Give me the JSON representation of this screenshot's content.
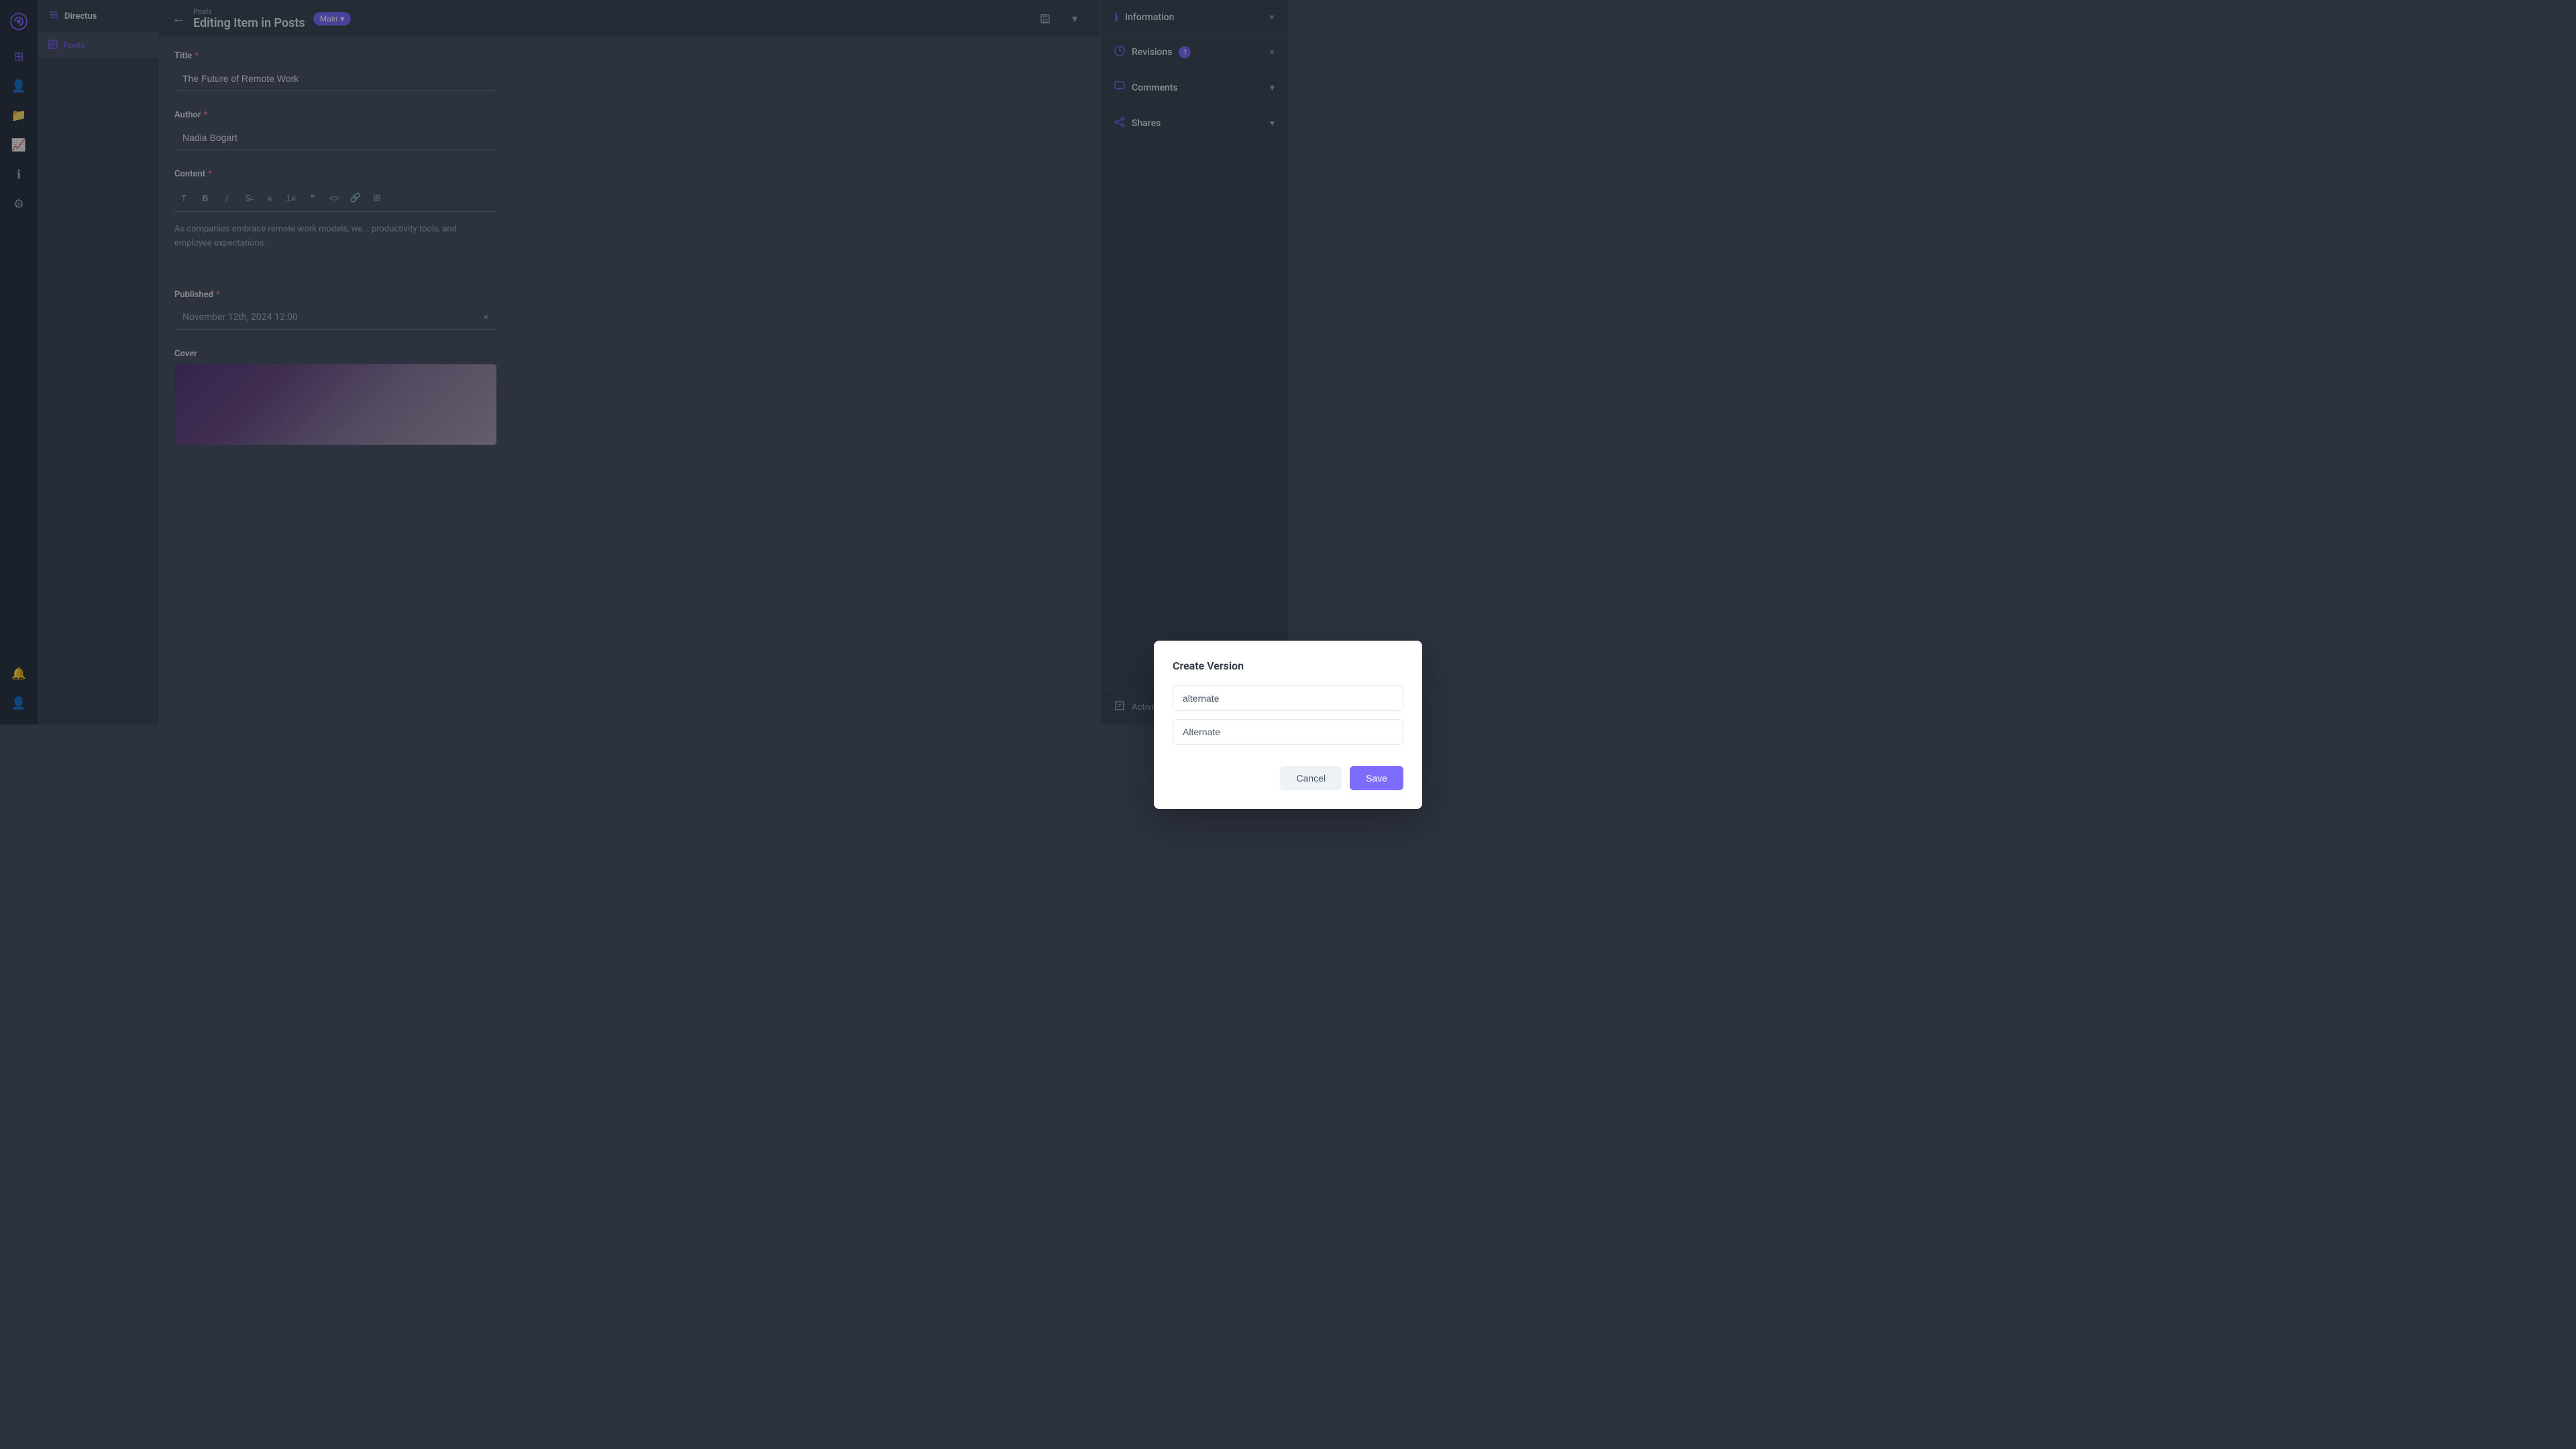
{
  "app": {
    "logo_text": "🦋",
    "name": "Directus"
  },
  "sidebar": {
    "items": [
      {
        "id": "collections",
        "icon": "⊞",
        "label": "Collections"
      },
      {
        "id": "users",
        "icon": "👤",
        "label": "Users"
      },
      {
        "id": "files",
        "icon": "📁",
        "label": "Files"
      },
      {
        "id": "insights",
        "icon": "📊",
        "label": "Insights"
      },
      {
        "id": "info",
        "icon": "ℹ",
        "label": "Info"
      },
      {
        "id": "settings",
        "icon": "⚙",
        "label": "Settings"
      }
    ],
    "bottom_items": [
      {
        "id": "notifications",
        "icon": "🔔",
        "label": "Notifications"
      },
      {
        "id": "profile",
        "icon": "👤",
        "label": "Profile"
      }
    ]
  },
  "left_panel": {
    "header": {
      "icon": "≡",
      "title": "Directus"
    },
    "items": [
      {
        "id": "posts",
        "icon": "≡",
        "label": "Posts",
        "active": true
      }
    ]
  },
  "topbar": {
    "breadcrumb": "Posts",
    "title": "Editing Item in Posts",
    "version_badge": "Main",
    "version_badge_chevron": "▾"
  },
  "form": {
    "title_label": "Title",
    "title_value": "The Future of Remote Work",
    "author_label": "Author",
    "author_value": "Nadia Bogart",
    "content_label": "Content",
    "content_text": "As companies embrace remote work models, we... productivity tools, and employee expectations.",
    "published_label": "Published",
    "published_value": "November 12th, 2024 12:00",
    "cover_label": "Cover"
  },
  "right_panel": {
    "sections": [
      {
        "id": "information",
        "icon": "ℹ",
        "label": "Information",
        "chevron": "×"
      },
      {
        "id": "revisions",
        "icon": "⟲",
        "label": "Revisions",
        "badge": "1",
        "chevron": "×"
      },
      {
        "id": "comments",
        "icon": "💬",
        "label": "Comments",
        "chevron": "▾"
      },
      {
        "id": "shares",
        "icon": "↗",
        "label": "Shares",
        "chevron": "▾"
      }
    ],
    "activity_log": "Activity Log"
  },
  "modal": {
    "title": "Create Version",
    "field1_value": "alternate",
    "field2_value": "Alternate",
    "cancel_label": "Cancel",
    "save_label": "Save"
  },
  "editor_tools": [
    "T",
    "B",
    "I",
    "≡",
    "≡",
    "≡",
    "❝",
    "<>",
    "🔗",
    "⊞"
  ]
}
